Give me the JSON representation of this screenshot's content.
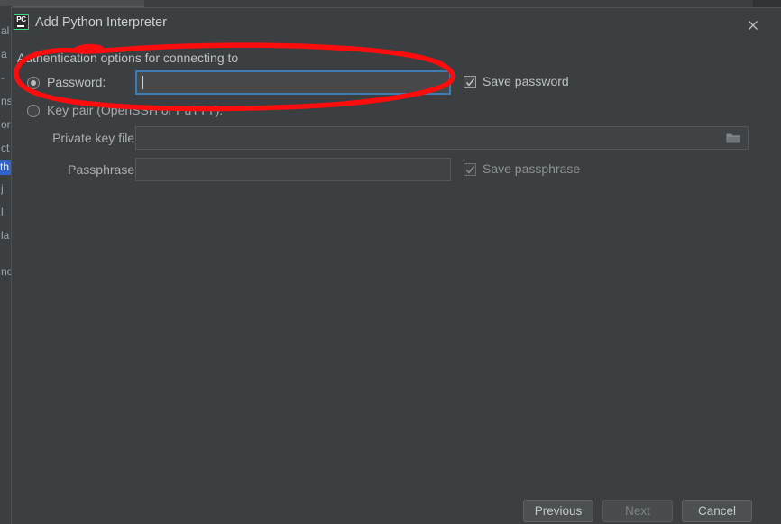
{
  "window": {
    "title": "Add Python Interpreter",
    "app_icon": "pycharm-icon",
    "icon_text": "PC",
    "close_icon": "close-icon"
  },
  "content": {
    "hint": "Authentication options for connecting to",
    "hint_redacted": true,
    "auth_options": [
      {
        "id": "password",
        "label": "Password:",
        "selected": true
      },
      {
        "id": "key-pair",
        "label": "Key pair (OpenSSH or PuTTY):",
        "selected": false
      }
    ],
    "password_field": {
      "value": "",
      "placeholder": "",
      "focused": true,
      "enabled": true
    },
    "save_password": {
      "label": "Save password",
      "checked": true,
      "enabled": true
    },
    "private_key_file": {
      "label": "Private key file:",
      "value": "",
      "placeholder": "",
      "enabled": false,
      "browse_icon": "folder-icon"
    },
    "passphrase": {
      "label": "Passphrase:",
      "value": "",
      "placeholder": "",
      "enabled": false
    },
    "save_passphrase": {
      "label": "Save passphrase",
      "checked": true,
      "enabled": false
    }
  },
  "footer": {
    "previous_label": "Previous",
    "next_label": "Next",
    "cancel_label": "Cancel",
    "next_enabled": false
  },
  "background": {
    "fragments": [
      "al",
      "a",
      "-",
      "ns",
      "or",
      "ct",
      "th",
      "j",
      "l",
      "la",
      "no"
    ],
    "highlighted_index": 6,
    "dropdown_icon": "chevron-down-icon"
  },
  "annotation": {
    "type": "hand-drawn-ellipse",
    "color": "#fb0d0d",
    "describes": "password-row"
  },
  "colors": {
    "dialog_bg": "#3c3f41",
    "field_bg": "#45494a",
    "focus_border": "#3f7cb4",
    "text": "#bcc1c4",
    "accent_green": "#3ddc84",
    "annotation_red": "#fb0d0d",
    "selection_blue": "#2f65ca"
  }
}
